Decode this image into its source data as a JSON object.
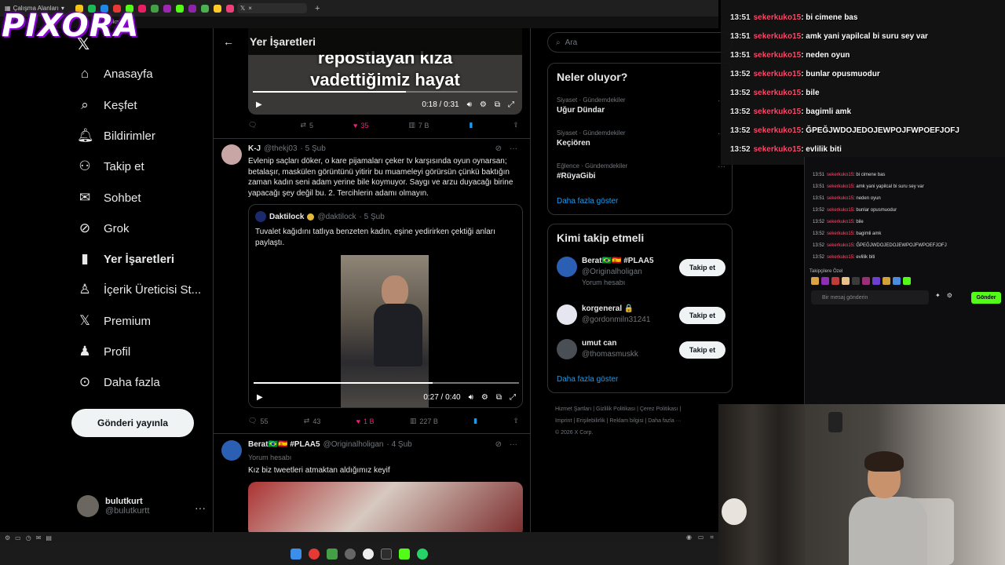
{
  "browser": {
    "workspace_label": "Çalışma Alanları",
    "active_tab_icon": "x-logo",
    "bookmarks_label": "bookmarks"
  },
  "overlay_logo": "PIXORA",
  "nav": {
    "items": [
      {
        "label": "Anasayfa",
        "icon": "home-icon"
      },
      {
        "label": "Keşfet",
        "icon": "search-icon"
      },
      {
        "label": "Bildirimler",
        "icon": "bell-icon"
      },
      {
        "label": "Takip et",
        "icon": "add-user-icon"
      },
      {
        "label": "Sohbet",
        "icon": "mail-icon"
      },
      {
        "label": "Grok",
        "icon": "grok-icon"
      },
      {
        "label": "Yer İşaretleri",
        "icon": "bookmark-icon"
      },
      {
        "label": "İçerik Üreticisi St...",
        "icon": "creator-icon"
      },
      {
        "label": "Premium",
        "icon": "x-icon"
      },
      {
        "label": "Profil",
        "icon": "person-icon"
      },
      {
        "label": "Daha fazla",
        "icon": "more-circle-icon"
      }
    ],
    "post_button": "Gönderi yayınla",
    "profile": {
      "name": "bulutkurt",
      "handle": "@bulutkurtt"
    }
  },
  "main": {
    "title": "Yer İşaretleri",
    "top_tweet": {
      "caption_line1": "repostlayan kıza",
      "caption_line2": "vadettiğimiz hayat",
      "time": "0:18 / 0:31",
      "replies": "",
      "reposts": "5",
      "likes": "35",
      "views": "7 B"
    },
    "tweet1": {
      "name": "K-J",
      "handle": "@thekj03",
      "time": "· 5 Şub",
      "text": "Evlenip saçları döker, o kare pijamaları çeker tv karşısında oyun oynarsan; betalaşır, maskülen görüntünü yitirir bu muameleyi görürsün çünkü baktığın zaman kadın seni adam yerine bile koymuyor. Saygı ve arzu duyacağı birine yapacağı şey değil bu. 2. Tercihlerin adamı olmayın.",
      "quote": {
        "name": "Daktilock",
        "handle": "@daktilock",
        "time": "· 5 Şub",
        "text": "Tuvalet kağıdını tatlıya benzeten kadın, eşine yedirirken çektiği anları paylaştı.",
        "video_time": "0:27 / 0:40",
        "progress": 0.675
      },
      "replies": "55",
      "reposts": "43",
      "likes": "1 B",
      "views": "227 B"
    },
    "tweet2": {
      "name": "Berat🇧🇷🇪🇸 #PLAA5",
      "handle": "@Originalholigan",
      "time": "· 4 Şub",
      "sub": "Yorum hesabı",
      "text": "Kız biz tweetleri atmaktan aldığımız keyif"
    }
  },
  "right": {
    "search_placeholder": "Ara",
    "trends_title": "Neler oluyor?",
    "trends": [
      {
        "category": "Siyaset · Gündemdekiler",
        "name": "Uğur Dündar"
      },
      {
        "category": "Siyaset · Gündemdekiler",
        "name": "Keçiören"
      },
      {
        "category": "Eğlence · Gündemdekiler",
        "name": "#RüyaGibi"
      }
    ],
    "show_more": "Daha fazla göster",
    "follow_title": "Kimi takip etmeli",
    "follows": [
      {
        "name": "Berat🇧🇷🇪🇸 #PLAA5",
        "handle": "@Originalholigan",
        "sub": "Yorum hesabı",
        "button": "Takip et"
      },
      {
        "name": "korgeneral 🔒",
        "handle": "@gordonmiln31241",
        "sub": "",
        "button": "Takip et"
      },
      {
        "name": "umut can",
        "handle": "@thomasmuskk",
        "sub": "",
        "button": "Takip et"
      }
    ],
    "show_more2": "Daha fazla göster",
    "footer_line1": "Hizmet Şartları  |  Gizlilik Politikası  |  Çerez Politikası  |",
    "footer_line2": "Imprint  |  Erişilebilirlik  |  Reklam bilgisi  |  Daha fazla ···",
    "footer_line3": "© 2026 X Corp."
  },
  "chat_overlay": [
    {
      "time": "13:51",
      "user": "sekerkuko15",
      "msg": ": bi cimene bas"
    },
    {
      "time": "13:51",
      "user": "sekerkuko15",
      "msg": ": amk yani yapilcal bi suru sey var"
    },
    {
      "time": "13:51",
      "user": "sekerkuko15",
      "msg": ": neden oyun"
    },
    {
      "time": "13:52",
      "user": "sekerkuko15",
      "msg": ": bunlar opusmuodur"
    },
    {
      "time": "13:52",
      "user": "sekerkuko15",
      "msg": ": bile"
    },
    {
      "time": "13:52",
      "user": "sekerkuko15",
      "msg": ": bagimli amk"
    },
    {
      "time": "13:52",
      "user": "sekerkuko15",
      "msg": ": ĞPEĞJWDOJEDOJEWPOJFWPOEFJOFJ"
    },
    {
      "time": "13:52",
      "user": "sekerkuko15",
      "msg": ": evlilik biti"
    }
  ],
  "kick_chat": {
    "lines": [
      {
        "time": "13:51",
        "user": "sekerkuko15",
        "msg": ": bi cimene bas"
      },
      {
        "time": "13:51",
        "user": "sekerkuko15",
        "msg": ": amk yani yapilcal bi suru sey var"
      },
      {
        "time": "13:51",
        "user": "sekerkuko15",
        "msg": ": neden oyun"
      },
      {
        "time": "13:52",
        "user": "sekerkuko15",
        "msg": ": bunlar opusmuodur"
      },
      {
        "time": "13:52",
        "user": "sekerkuko15",
        "msg": ": bile"
      },
      {
        "time": "13:52",
        "user": "sekerkuko15",
        "msg": ": bagimli amk"
      },
      {
        "time": "13:52",
        "user": "sekerkuko15",
        "msg": ": ĞPEĞJWDOJEDOJEWPOJFWPOEFJOFJ"
      },
      {
        "time": "13:52",
        "user": "sekerkuko15",
        "msg": ": evlilik biti"
      }
    ],
    "subscribers_label": "Takipçilere Özel",
    "input_placeholder": "Bir mesaj gönderin",
    "send_button": "Gönder"
  },
  "colors": {
    "accent": "#1d9bf0",
    "like": "#f91880",
    "kick_green": "#53fc18",
    "chat_user": "#ff4a6e"
  }
}
